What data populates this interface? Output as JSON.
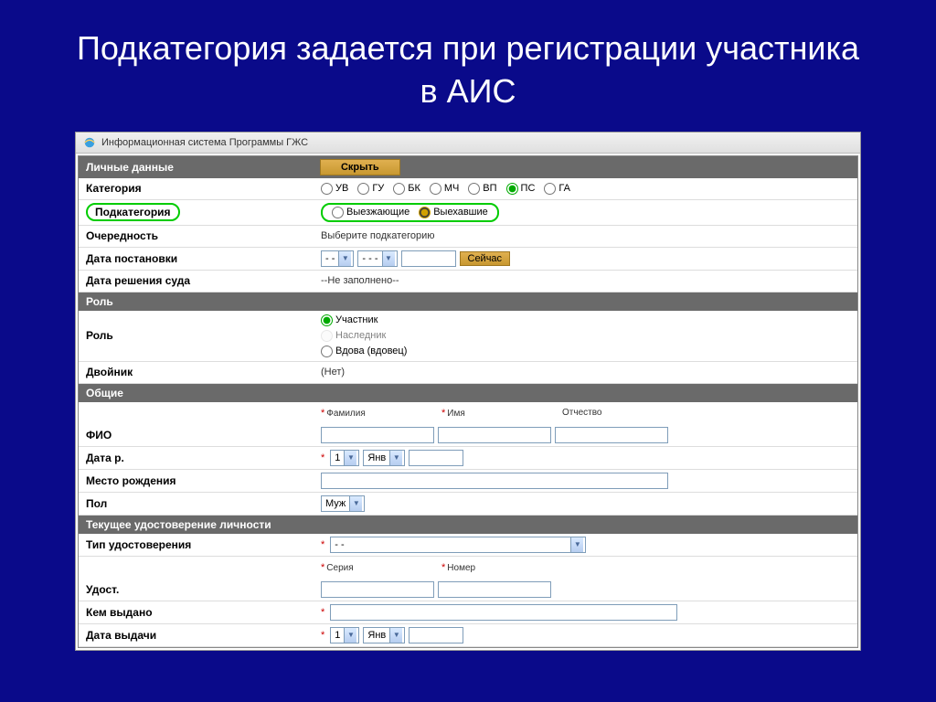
{
  "slide_title": "Подкатегория задается при регистрации участника в АИС",
  "titlebar": "Информационная система Программы ГЖС",
  "sections": {
    "personal": "Личные данные",
    "role": "Роль",
    "general": "Общие",
    "id_doc": "Текущее удостоверение личности"
  },
  "hide_btn": "Скрыть",
  "labels": {
    "category": "Категория",
    "subcategory": "Подкатегория",
    "priority": "Очередность",
    "reg_date": "Дата постановки",
    "court_date": "Дата решения суда",
    "role": "Роль",
    "double": "Двойник",
    "fio": "ФИО",
    "birth_date": "Дата р.",
    "birth_place": "Место рождения",
    "gender": "Пол",
    "id_type": "Тип удостоверения",
    "id_doc": "Удост.",
    "issued_by": "Кем выдано",
    "issue_date": "Дата выдачи"
  },
  "category_options": [
    "УВ",
    "ГУ",
    "БК",
    "МЧ",
    "ВП",
    "ПС",
    "ГА"
  ],
  "category_selected": "ПС",
  "subcategory_options": [
    "Выезжающие",
    "Выехавшие"
  ],
  "subcategory_selected": "Выехавшие",
  "priority_placeholder": "Выберите подкатегорию",
  "date_selects": {
    "day": "- -",
    "month": "- - -",
    "year": ""
  },
  "now_btn": "Сейчас",
  "court_date_value": "--Не заполнено--",
  "role_options": [
    "Участник",
    "Наследник",
    "Вдова (вдовец)"
  ],
  "role_selected": "Участник",
  "double_value": "(Нет)",
  "name_cols": {
    "last": "Фамилия",
    "first": "Имя",
    "mid": "Отчество"
  },
  "birth_day": "1",
  "birth_month": "Янв",
  "gender_value": "Муж",
  "id_type_value": "- -",
  "id_cols": {
    "series": "Серия",
    "number": "Номер"
  },
  "issue_day": "1",
  "issue_month": "Янв"
}
